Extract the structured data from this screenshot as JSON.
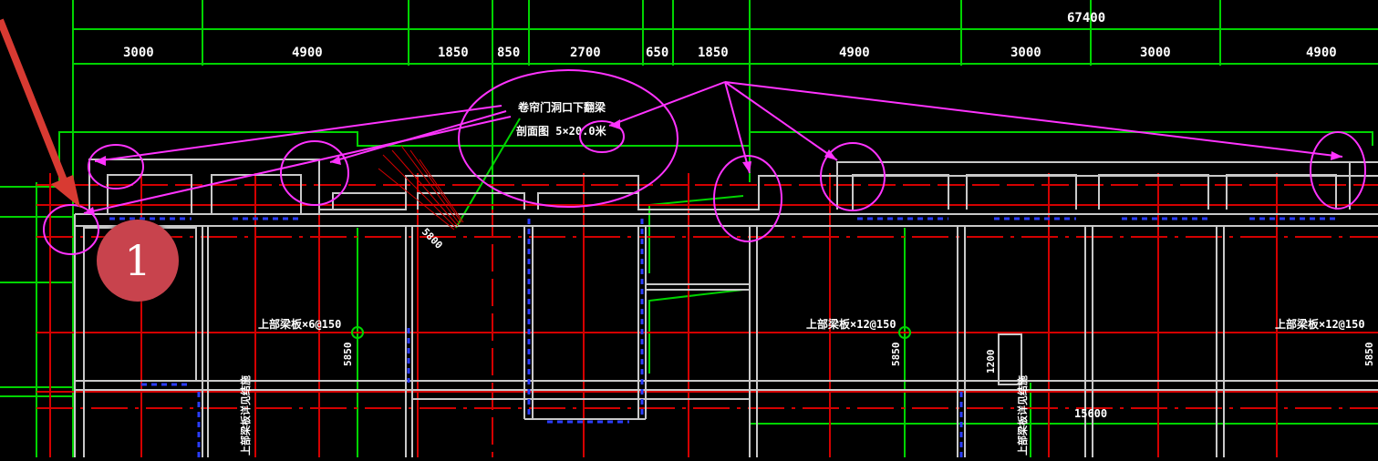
{
  "drawing": {
    "total_dimension": "67400",
    "dimensions": [
      "3000",
      "4900",
      "1850",
      "850",
      "2700",
      "650",
      "1850",
      "4900",
      "3000",
      "3000",
      "4900"
    ],
    "annotation_line1": "卷帘门洞口下翻梁",
    "annotation_line2": "剖面图 5×20.0米",
    "room_labels": [
      "上部梁板×6@150",
      "上部梁板×12@150",
      "上部梁板×12@150"
    ],
    "vertical_dims": [
      "5850",
      "5850",
      "5850",
      "1200"
    ],
    "bottom_labels": [
      "上部梁板详见结施",
      "上部梁板详见结施"
    ],
    "stair_label": "5800",
    "lower_dim": "15600",
    "marker_number": "1"
  },
  "colors": {
    "background": "#000000",
    "green": "#00d400",
    "red": "#d40000",
    "magenta": "#ff33ff",
    "wall": "#c8c8c8",
    "blue_dash": "#2a3cff",
    "white": "#ffffff",
    "marker_fill": "#c8434d",
    "arrow": "#d83a32"
  }
}
